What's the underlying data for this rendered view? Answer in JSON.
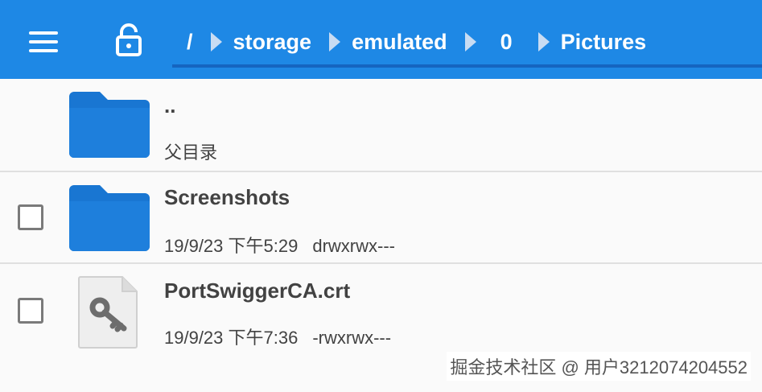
{
  "toolbar": {
    "menu_icon": "menu-icon",
    "lock_icon": "lock-open-icon",
    "accent_color": "#1e88e5"
  },
  "breadcrumb": {
    "items": [
      "/",
      "storage",
      "emulated",
      "0",
      "Pictures"
    ]
  },
  "files": [
    {
      "name": "..",
      "meta": "父目录",
      "perm": "",
      "type": "parent"
    },
    {
      "name": "Screenshots",
      "meta": "19/9/23 下午5:29",
      "perm": "drwxrwx---",
      "type": "folder"
    },
    {
      "name": "PortSwiggerCA.crt",
      "meta": "19/9/23 下午7:36",
      "perm": "-rwxrwx---",
      "type": "file"
    }
  ],
  "watermark": "掘金技术社区 @ 用户3212074204552"
}
